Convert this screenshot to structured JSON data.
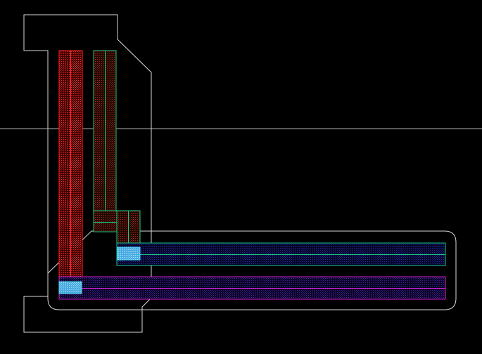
{
  "view": {
    "background": "#000000",
    "crosshair_color": "#c8c8c8"
  },
  "layers": [
    {
      "id": "boundary",
      "name": "outline",
      "stroke": "#d8d8d8"
    },
    {
      "id": "poly-red",
      "name": "red-fill",
      "stroke": "#ff2020",
      "fill": "#b01818"
    },
    {
      "id": "poly-green",
      "name": "green-outline",
      "stroke": "#18c880",
      "fill": "#2a1a10"
    },
    {
      "id": "via-cyan",
      "name": "cyan-contact",
      "stroke": "#40d0f0",
      "fill": "#60c8f0"
    },
    {
      "id": "metal-teal",
      "name": "teal-metal",
      "stroke": "#18c890",
      "fill": "#101060"
    },
    {
      "id": "metal-magenta",
      "name": "magenta-metal",
      "stroke": "#d020d0",
      "fill": "#1a0a50"
    }
  ],
  "icons": {
    "crosshair": "crosshair-icon"
  }
}
